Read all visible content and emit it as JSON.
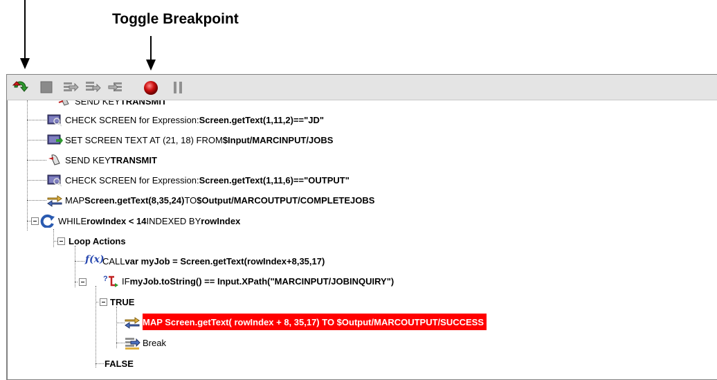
{
  "callouts": {
    "toggle_breakpoint": "Toggle Breakpoint"
  },
  "toolbar": {
    "buttons": [
      {
        "name": "run",
        "icon": "run-icon"
      },
      {
        "name": "stop",
        "icon": "stop-icon"
      },
      {
        "name": "step-into",
        "icon": "step-into-icon"
      },
      {
        "name": "step-over",
        "icon": "step-over-icon"
      },
      {
        "name": "step-out",
        "icon": "step-out-icon"
      },
      {
        "name": "toggle-breakpoint",
        "icon": "breakpoint-icon"
      },
      {
        "name": "pause",
        "icon": "pause-icon"
      }
    ]
  },
  "tree": {
    "rows": [
      {
        "prefix": "SEND KEY ",
        "bold": "TRANSMIT",
        "suffix": "",
        "icon": "send-key-icon"
      },
      {
        "prefix": "CHECK SCREEN for Expression: ",
        "bold": "Screen.getText(1,11,2)==\"JD\"",
        "suffix": "",
        "icon": "check-screen-icon"
      },
      {
        "prefix": "SET SCREEN TEXT AT (21, 18) FROM ",
        "bold": "$Input/MARCINPUT/JOBS",
        "suffix": "",
        "icon": "set-screen-text-icon"
      },
      {
        "prefix": "SEND KEY ",
        "bold": "TRANSMIT",
        "suffix": "",
        "icon": "send-key-icon"
      },
      {
        "prefix": "CHECK SCREEN for Expression: ",
        "bold": "Screen.getText(1,11,6)==\"OUTPUT\"",
        "suffix": "",
        "icon": "check-screen-icon"
      },
      {
        "prefix": "MAP ",
        "bold": "Screen.getText(8,35,24)",
        "mid": " TO ",
        "bold2": "$Output/MARCOUTPUT/COMPLETEJOBS",
        "icon": "map-icon"
      },
      {
        "prefix": "WHILE ",
        "bold": "rowIndex < 14",
        "mid": " INDEXED BY ",
        "bold2": "rowIndex",
        "icon": "while-loop-icon"
      },
      {
        "prefix": "",
        "bold": "Loop Actions",
        "suffix": "",
        "icon": ""
      },
      {
        "prefix": "CALL ",
        "bold": "var myJob = Screen.getText(rowIndex+8,35,17)",
        "suffix": "",
        "icon": "function-icon"
      },
      {
        "prefix": "IF ",
        "bold": "myJob.toString() == Input.XPath(\"MARCINPUT/JOBINQUIRY\")",
        "suffix": "",
        "icon": "if-icon"
      },
      {
        "prefix": "",
        "bold": "TRUE",
        "suffix": "",
        "icon": ""
      },
      {
        "prefix": "",
        "bold": "MAP Screen.getText( rowIndex + 8, 35,17) TO $Output/MARCOUTPUT/SUCCESS",
        "suffix": "",
        "icon": "map-icon"
      },
      {
        "prefix": "Break",
        "bold": "",
        "suffix": "",
        "icon": "break-icon"
      },
      {
        "prefix": "",
        "bold": "FALSE",
        "suffix": "",
        "icon": ""
      }
    ]
  },
  "colors": {
    "selection": "#ff0000",
    "toolbar_bg": "#e4e4e4"
  }
}
